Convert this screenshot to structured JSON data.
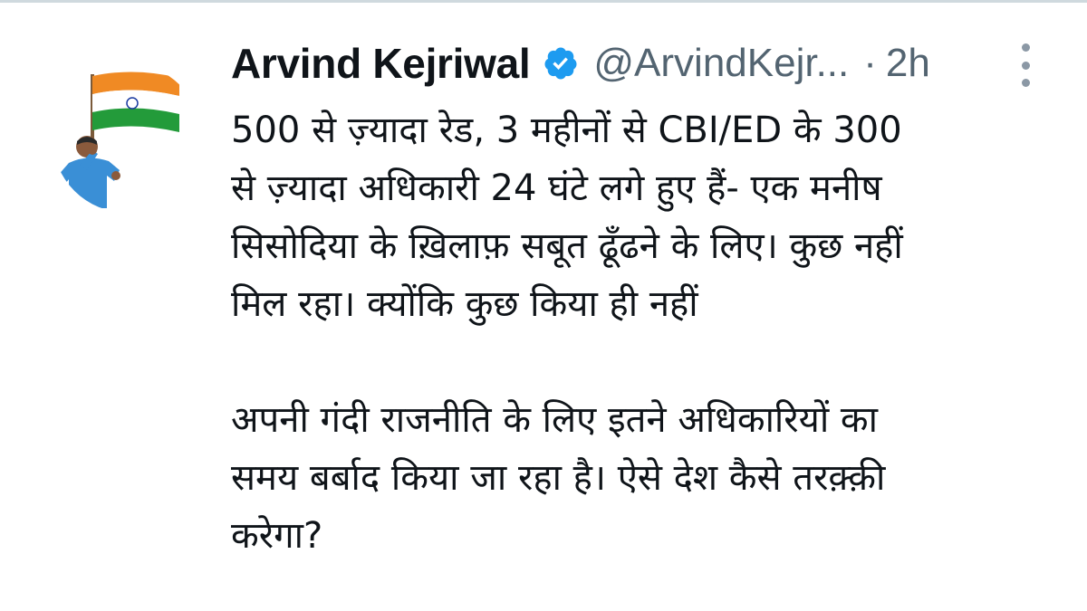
{
  "tweet": {
    "author_name": "Arvind Kejriwal",
    "handle": "@ArvindKejr...",
    "separator": "·",
    "time": "2h",
    "verified_color": "#1d9bf0",
    "lines": [
      "500 से ज़्यादा रेड, 3 महीनों से CBI/ED के 300",
      "से ज़्यादा अधिकारी 24 घंटे लगे हुए हैं- एक मनीष",
      "सिसोदिया के ख़िलाफ़ सबूत ढूँढने के लिए। कुछ नहीं",
      "मिल रहा। क्योंकि कुछ किया ही नहीं",
      "अपनी गंदी राजनीति के लिए इतने अधिकारियों का",
      "समय बर्बाद किया जा रहा है। ऐसे देश कैसे तरक़्क़ी",
      "करेगा?"
    ]
  },
  "icons": {
    "verified": "verified-badge-icon",
    "more": "more-options-icon"
  },
  "colors": {
    "text": "#0f1419",
    "secondary": "#536471",
    "saffron": "#f08a24",
    "green": "#239b3a",
    "shirt": "#3a8fd6"
  }
}
